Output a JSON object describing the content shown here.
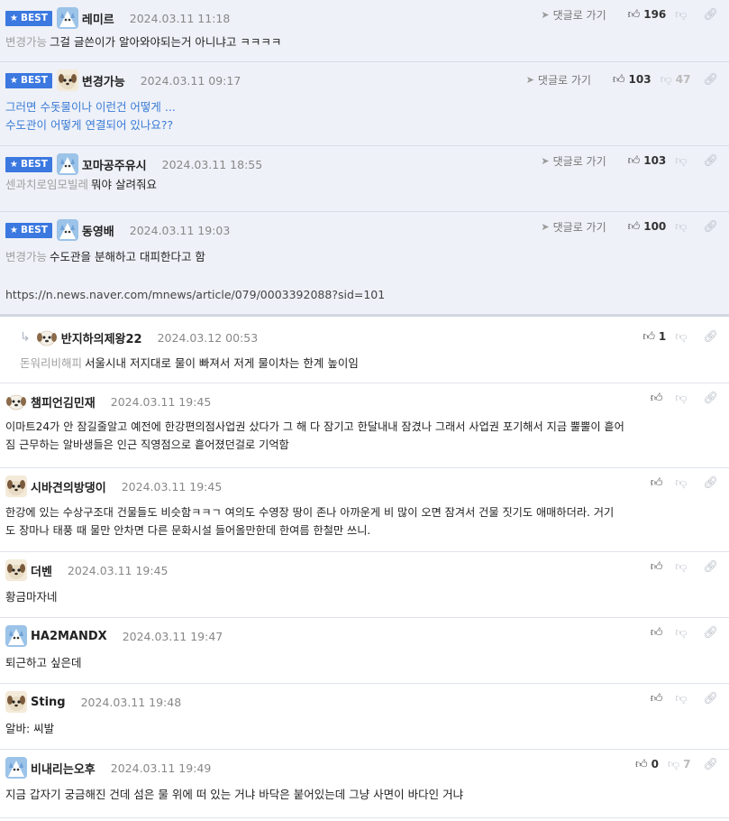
{
  "labels": {
    "best_badge": "BEST",
    "goto_reply": "댓글로 가기"
  },
  "colors": {
    "best_bg": "#eef1f8",
    "badge_blue": "#3b78e0",
    "highlight_text": "#3a7bd5",
    "date_gray": "#888888"
  },
  "comments": [
    {
      "nick": "레미르",
      "date": "2024.03.11 11:18",
      "up": "196",
      "down": "",
      "prefix": "변경가능",
      "lines": [
        "그걸 글쓴이가 알아와야되는거 아니냐고 ㅋㅋㅋㅋ"
      ]
    },
    {
      "nick": "변경가능",
      "date": "2024.03.11 09:17",
      "up": "103",
      "down": "47",
      "prefix": "",
      "lines": [
        "그러면 수돗물이나 이런건 어떻게 ...",
        "수도관이 어떻게 연결되어 있나요??"
      ]
    },
    {
      "nick": "꼬마공주유시",
      "date": "2024.03.11 18:55",
      "up": "103",
      "down": "",
      "prefix": "센과치로임모빌레",
      "lines": [
        "뭐야 살려줘요"
      ]
    },
    {
      "nick": "동영배",
      "date": "2024.03.11 19:03",
      "up": "100",
      "down": "",
      "prefix": "변경가능",
      "lines": [
        "수도관을 분해하고 대피한다고 함"
      ],
      "url": "https://n.news.naver.com/mnews/article/079/0003392088?sid=101"
    },
    {
      "nick": "반지하의제왕22",
      "date": "2024.03.12 00:53",
      "up": "1",
      "down": "",
      "prefix": "돈워리비해피",
      "lines": [
        "서울시내 저지대로 물이 빠져서 저게 물이차는 한계 높이임"
      ]
    },
    {
      "nick": "챔피언김민재",
      "date": "2024.03.11 19:45",
      "up": "",
      "down": "",
      "prefix": "",
      "lines": [
        "이마트24가 안 잠길줄알고 예전에 한강편의점사업권 샀다가 그 해 다 잠기고 한달내내 잠겼나 그래서 사업권 포기해서 지금 뿔뿔이 흩어",
        "짐 근무하는 알바생들은 인근 직영점으로 흩어졌던걸로 기억함"
      ]
    },
    {
      "nick": "시바견의방댕이",
      "date": "2024.03.11 19:45",
      "up": "",
      "down": "",
      "prefix": "",
      "lines": [
        "한강에 있는 수상구조대 건물들도 비슷함ㅋㅋㄱ 여의도 수영장 땅이 존나 아까운게 비 많이 오면 잠겨서 건물 짓기도 애매하더라. 거기",
        "도 장마나 태풍 때 물만 안차면 다른 문화시설 들어올만한데 한여름 한철만 쓰니."
      ]
    },
    {
      "nick": "더벤",
      "date": "2024.03.11 19:45",
      "up": "",
      "down": "",
      "prefix": "",
      "lines": [
        "황금마자네"
      ]
    },
    {
      "nick": "HA2MANDX",
      "date": "2024.03.11 19:47",
      "up": "",
      "down": "",
      "prefix": "",
      "lines": [
        "퇴근하고 싶은데"
      ]
    },
    {
      "nick": "Sting",
      "date": "2024.03.11 19:48",
      "up": "",
      "down": "",
      "prefix": "",
      "lines": [
        "알바: 씨발"
      ]
    },
    {
      "nick": "비내리는오후",
      "date": "2024.03.11 19:49",
      "up": "0",
      "down": "7",
      "prefix": "",
      "lines": [
        "지금 갑자기 궁금해진 건데 섬은 물 위에 떠 있는 거냐 바닥은 붙어있는데 그냥 사면이 바다인 거냐"
      ]
    }
  ]
}
